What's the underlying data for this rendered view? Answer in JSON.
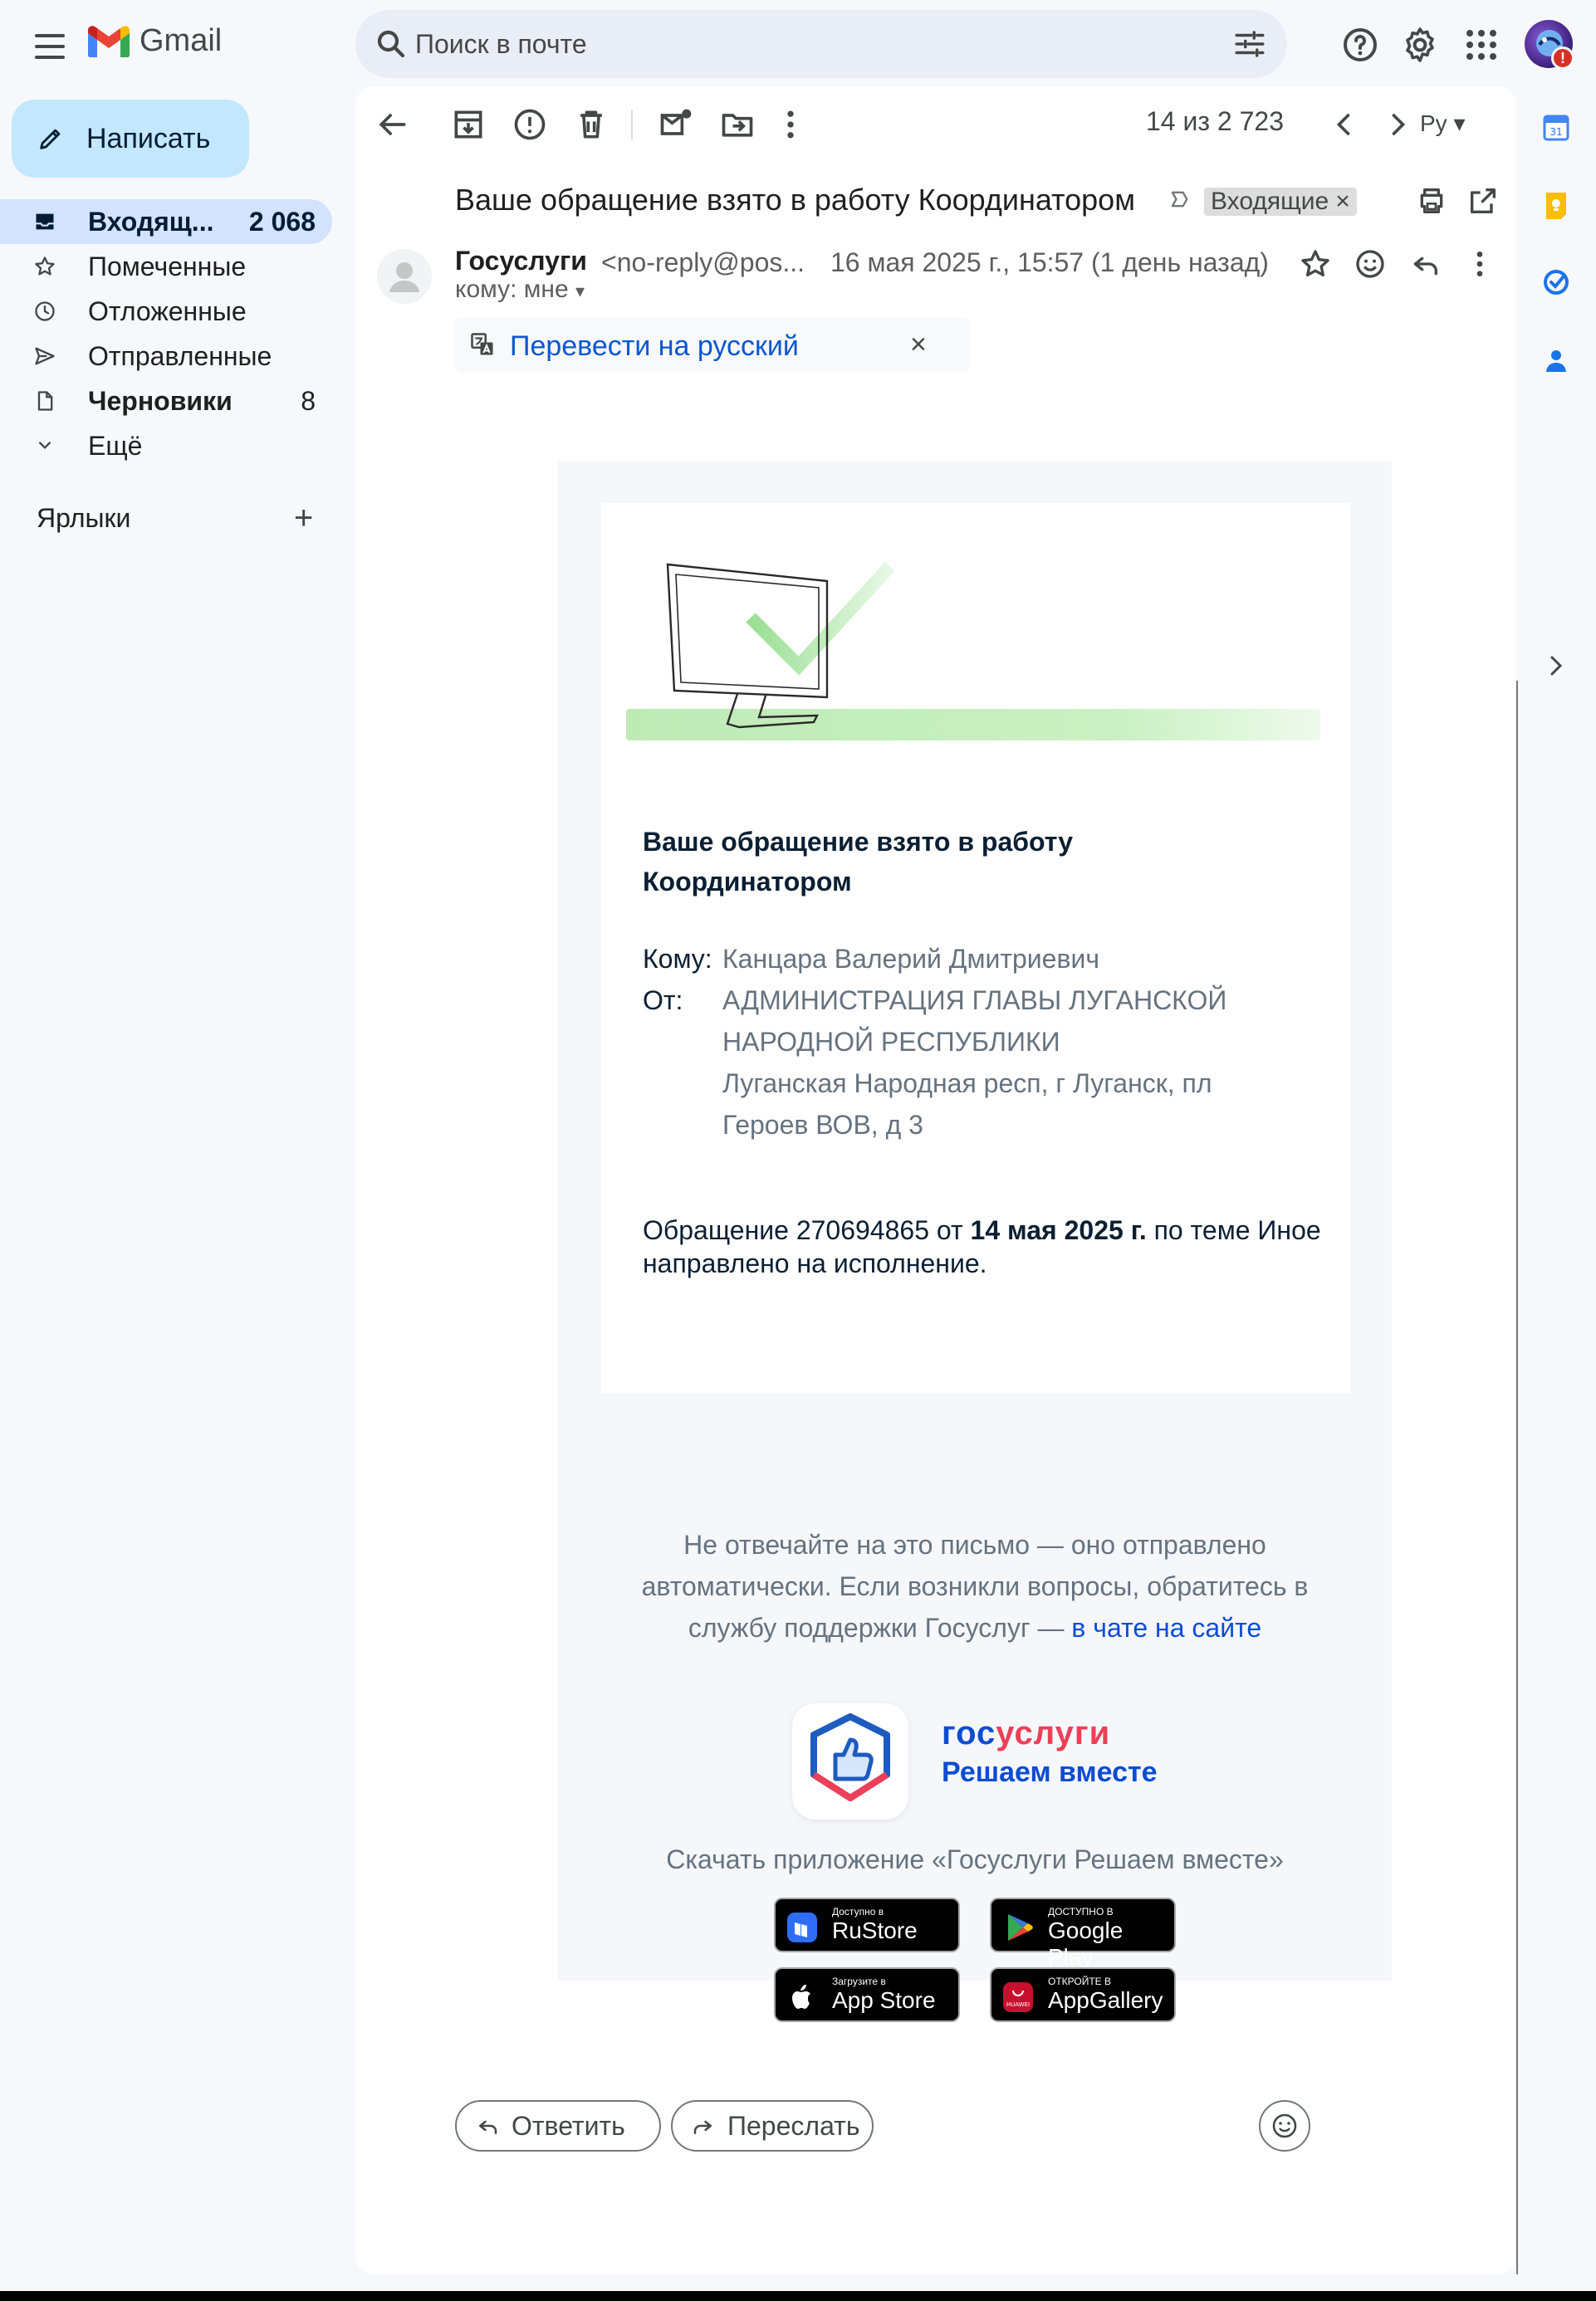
{
  "app": {
    "name": "Gmail"
  },
  "search": {
    "placeholder": "Поиск в почте"
  },
  "compose": {
    "label": "Написать"
  },
  "nav": {
    "items": [
      {
        "label": "Входящ...",
        "count": "2 068"
      },
      {
        "label": "Помеченные",
        "count": ""
      },
      {
        "label": "Отложенные",
        "count": ""
      },
      {
        "label": "Отправленные",
        "count": ""
      },
      {
        "label": "Черновики",
        "count": "8"
      },
      {
        "label": "Ещё",
        "count": ""
      }
    ],
    "labels_heading": "Ярлыки",
    "labels_add": "+"
  },
  "toolbar": {
    "pager": "14 из 2 723",
    "lang": "Ру"
  },
  "message": {
    "subject": "Ваше обращение взято в работу Координатором",
    "label_chip": "Входящие",
    "label_chip_close": "×",
    "sender_name": "Госуслуги",
    "sender_addr": "<no-reply@pos...",
    "date": "16 мая 2025 г., 15:57 (1 день назад)",
    "to": "кому: мне",
    "translate": {
      "link": "Перевести на русский",
      "close": "×"
    }
  },
  "email_body": {
    "title": "Ваше обращение взято в работу Координатором",
    "to_key": "Кому:",
    "to_value": "Канцара Валерий Дмитриевич",
    "from_key": "От:",
    "from_org": "АДМИНИСТРАЦИЯ ГЛАВЫ ЛУГАНСКОЙ НАРОДНОЙ РЕСПУБЛИКИ",
    "from_addr": "Луганская Народная респ, г Луганск, пл Героев ВОВ, д 3",
    "text_1": "Обращение 270694865 от ",
    "text_date": "14 мая 2025 г.",
    "text_2": " по теме Иное направлено на исполнение.",
    "notice": "Не отвечайте на это письмо — оно отправлено автоматически. Если возникли вопросы, обратитесь в службу поддержки Госуслуг — ",
    "notice_link": "в чате на сайте",
    "brand_a": "гос",
    "brand_b": "услуги",
    "brand_tag": "Решаем вместе",
    "download": "Скачать приложение «Госуслуги Решаем вместе»",
    "stores": [
      {
        "small": "Доступно в",
        "big": "RuStore"
      },
      {
        "small": "ДОСТУПНО В",
        "big": "Google Play"
      },
      {
        "small": "Загрузите в",
        "big": "App Store"
      },
      {
        "small": "ОТКРОЙТЕ В",
        "big": "AppGallery"
      }
    ],
    "store_huawei_mark": "HUAWEI"
  },
  "actions": {
    "reply": "Ответить",
    "forward": "Переслать"
  },
  "colors": {
    "accent": "#0b57d0",
    "compose_bg": "#c2e7ff",
    "active_nav": "#d3e3fd",
    "brand_blue": "#0d4cd3",
    "brand_red": "#ee3f58"
  }
}
